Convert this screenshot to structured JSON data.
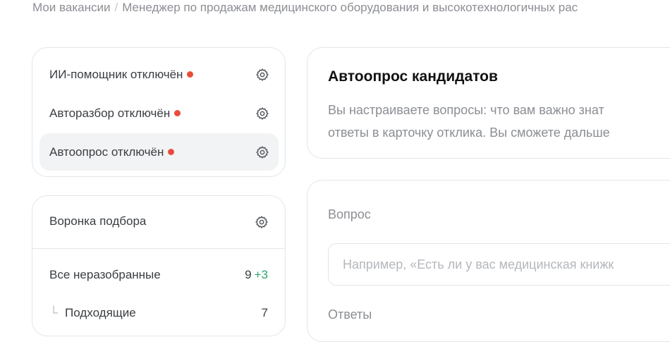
{
  "breadcrumb": {
    "root": "Мои вакансии",
    "separator": "/",
    "current": "Менеджер по продажам медицинского оборудования и высокотехнологичных рас"
  },
  "ai_settings": {
    "items": [
      {
        "label": "ИИ-помощник отключён",
        "status": "off",
        "icon": "gear-icon"
      },
      {
        "label": "Авторазбор отключён",
        "status": "off",
        "icon": "gear-icon"
      },
      {
        "label": "Автоопрос отключён",
        "status": "off",
        "icon": "gear-icon",
        "active": true
      }
    ],
    "status_color": "#ea4c3b"
  },
  "funnel": {
    "title": "Воронка подбора",
    "rows": [
      {
        "label": "Все неразобранные",
        "count": "9",
        "delta": "+3"
      },
      {
        "branch": "└",
        "label": "Подходящие",
        "count": "7"
      }
    ],
    "delta_color": "#2fa46a"
  },
  "autopoll": {
    "title": "Автоопрос кандидатов",
    "desc_line1": "Вы настраиваете вопросы: что вам важно знат",
    "desc_line2": "ответы в карточку отклика. Вы сможете дальше"
  },
  "question": {
    "label": "Вопрос",
    "placeholder": "Например, «Есть ли у вас медицинская книжк",
    "value": "",
    "answers_label": "Ответы"
  }
}
